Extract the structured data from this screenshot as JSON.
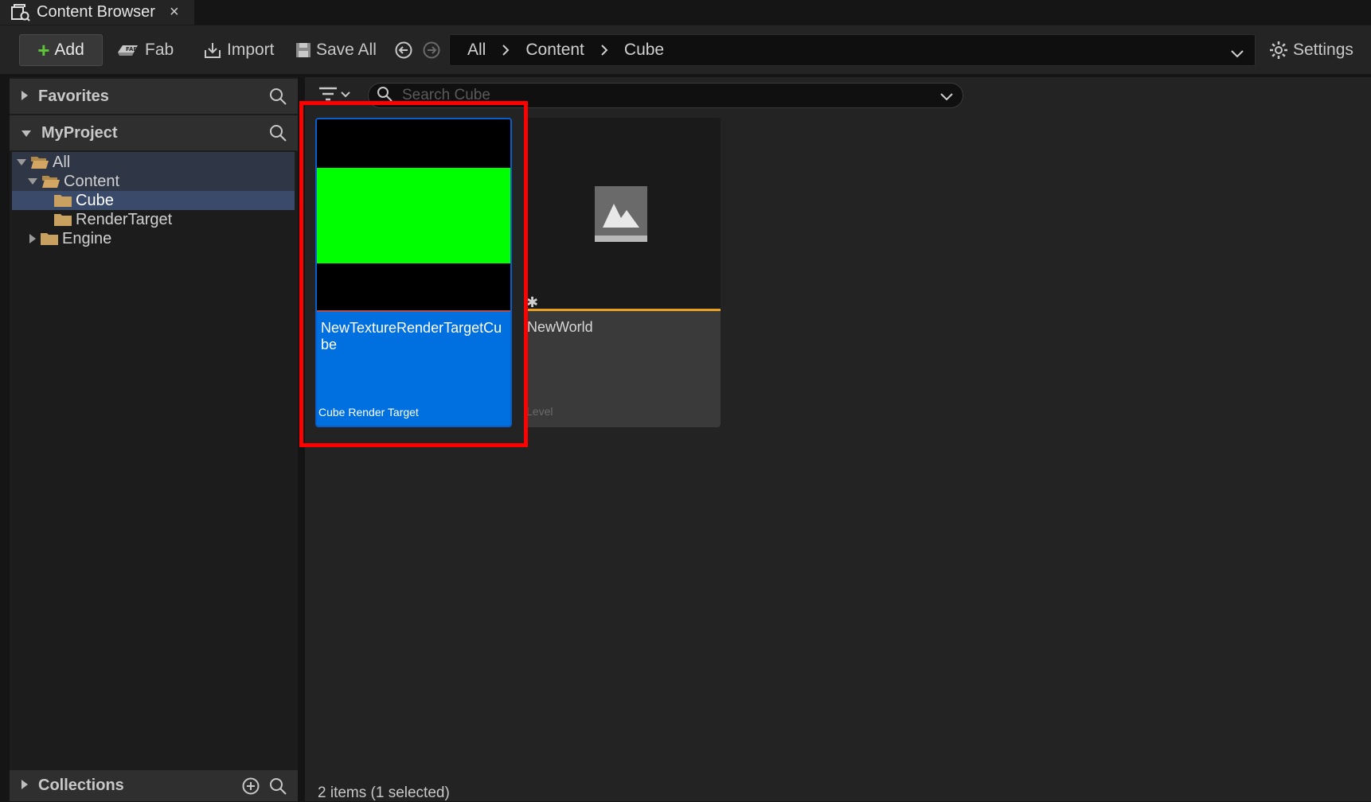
{
  "tab": {
    "title": "Content Browser",
    "close": "×"
  },
  "toolbar": {
    "add_label": "Add",
    "fab_label": "Fab",
    "import_label": "Import",
    "saveall_label": "Save All",
    "settings_label": "Settings"
  },
  "breadcrumb": {
    "items": [
      "All",
      "Content",
      "Cube"
    ]
  },
  "sections": {
    "favorites": "Favorites",
    "myproject": "MyProject",
    "collections": "Collections"
  },
  "tree": {
    "items": [
      "All",
      "Content",
      "Cube",
      "RenderTarget",
      "Engine"
    ],
    "selected": "Cube"
  },
  "search": {
    "placeholder": "Search Cube"
  },
  "assets": [
    {
      "name": "NewTextureRenderTargetCube",
      "type": "Cube Render Target",
      "selected": true
    },
    {
      "name": "NewWorld",
      "type": "Level",
      "selected": false
    }
  ],
  "status": {
    "text": "2 items (1 selected)"
  },
  "colors": {
    "accent": "#0070e0",
    "green_preview": "#00ff00",
    "level_underline": "#e8a020",
    "highlight": "#ff0000",
    "folder": "#c8a060"
  }
}
